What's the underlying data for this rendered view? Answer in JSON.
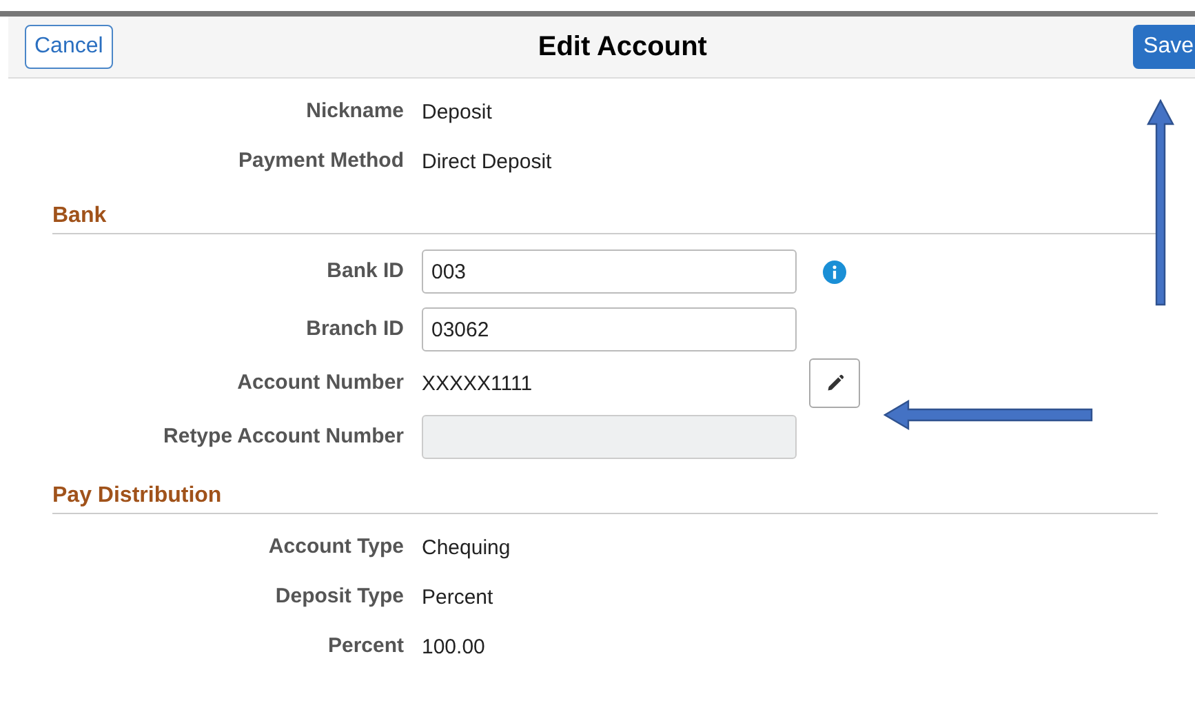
{
  "header": {
    "cancel": "Cancel",
    "title": "Edit Account",
    "save": "Save"
  },
  "sections": [
    {
      "rows": [
        {
          "label": "Nickname",
          "kind": "text",
          "value": "Deposit"
        },
        {
          "label": "Payment Method",
          "kind": "text",
          "value": "Direct Deposit"
        }
      ]
    },
    {
      "title": "Bank",
      "rows": [
        {
          "label": "Bank ID",
          "kind": "input",
          "value": "003",
          "addon": {
            "kind": "info"
          }
        },
        {
          "label": "Branch ID",
          "kind": "input",
          "value": "03062"
        },
        {
          "label": "Account Number",
          "kind": "text",
          "value": "XXXXX1111",
          "addon": {
            "kind": "edit"
          }
        },
        {
          "label": "Retype Account Number",
          "kind": "input",
          "value": "",
          "disabled": true
        }
      ]
    },
    {
      "title": "Pay Distribution",
      "rows": [
        {
          "label": "Account Type",
          "kind": "text",
          "value": "Chequing"
        },
        {
          "label": "Deposit Type",
          "kind": "text",
          "value": "Percent"
        },
        {
          "label": "Percent",
          "kind": "text",
          "value": "100.00"
        }
      ]
    }
  ]
}
